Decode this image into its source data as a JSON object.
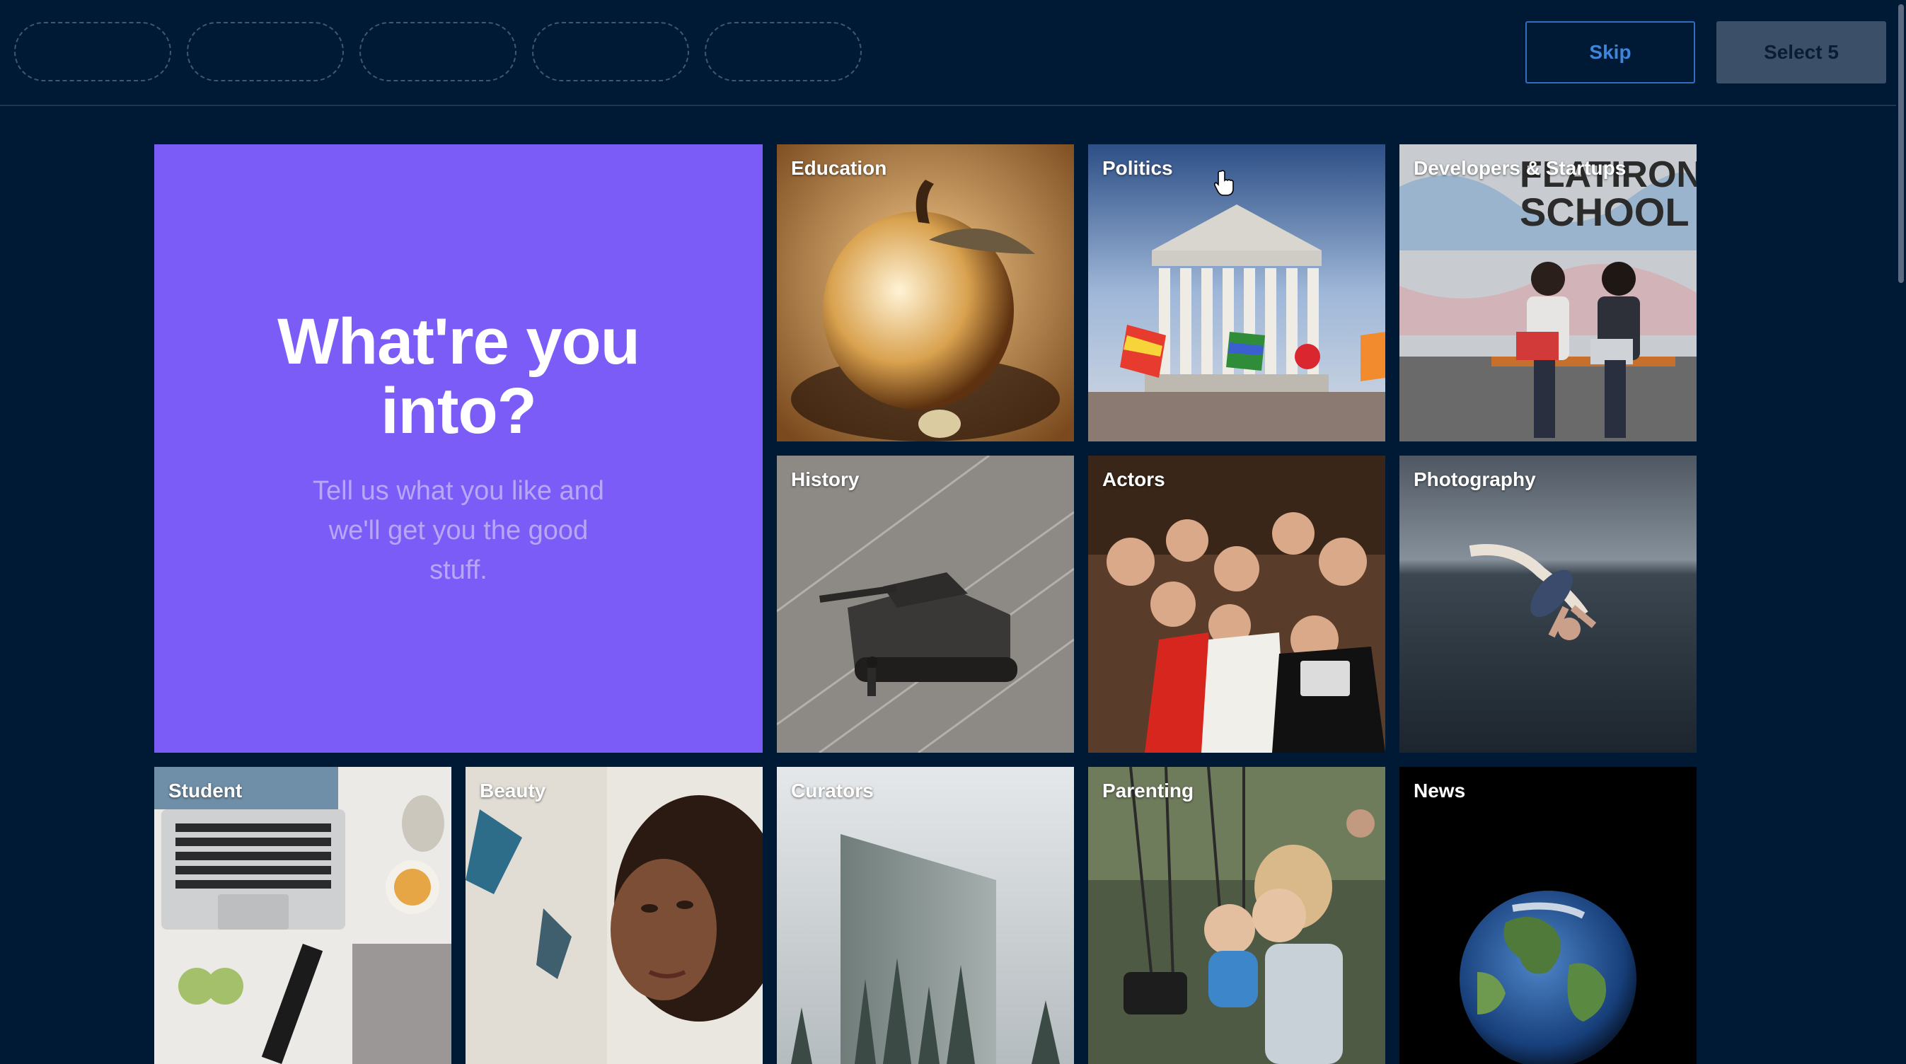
{
  "header": {
    "skip_label": "Skip",
    "select_label": "Select 5"
  },
  "hero": {
    "title": "What're you into?",
    "subtitle": "Tell us what you like and we'll get you the good stuff."
  },
  "topics": [
    {
      "label": "Education"
    },
    {
      "label": "Politics"
    },
    {
      "label": "Developers & Startups"
    },
    {
      "label": "History"
    },
    {
      "label": "Actors"
    },
    {
      "label": "Photography"
    },
    {
      "label": "Student"
    },
    {
      "label": "Beauty"
    },
    {
      "label": "Curators"
    },
    {
      "label": "Parenting"
    },
    {
      "label": "News"
    }
  ],
  "colors": {
    "background": "#001935",
    "hero": "#7c5cf6",
    "skip_border": "#2e6fbf"
  }
}
